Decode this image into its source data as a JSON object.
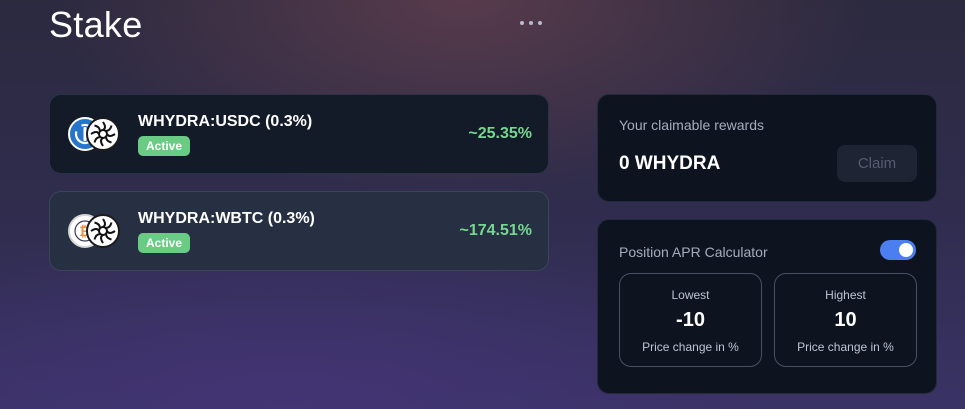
{
  "header": {
    "title": "Stake",
    "menu_icon": "more-horizontal-icon"
  },
  "pools": [
    {
      "name": "WHYDRA:USDC (0.3%)",
      "status": "Active",
      "apr": "~25.35%",
      "token_icons": [
        "usdc-icon",
        "whydra-icon"
      ]
    },
    {
      "name": "WHYDRA:WBTC (0.3%)",
      "status": "Active",
      "apr": "~174.51%",
      "token_icons": [
        "wbtc-icon",
        "whydra-icon"
      ]
    }
  ],
  "rewards": {
    "label": "Your claimable rewards",
    "amount": "0 WHYDRA",
    "claim_label": "Claim"
  },
  "calculator": {
    "label": "Position APR Calculator",
    "toggle_on": true,
    "lowest": {
      "title": "Lowest",
      "value": "-10",
      "subtitle": "Price change in %"
    },
    "highest": {
      "title": "Highest",
      "value": "10",
      "subtitle": "Price change in %"
    }
  },
  "colors": {
    "accent_green": "#76d790",
    "badge_green": "#6acb84",
    "toggle_blue": "#4b7ef0",
    "usdc_blue": "#2775ca",
    "wbtc_orange": "#f09242"
  }
}
